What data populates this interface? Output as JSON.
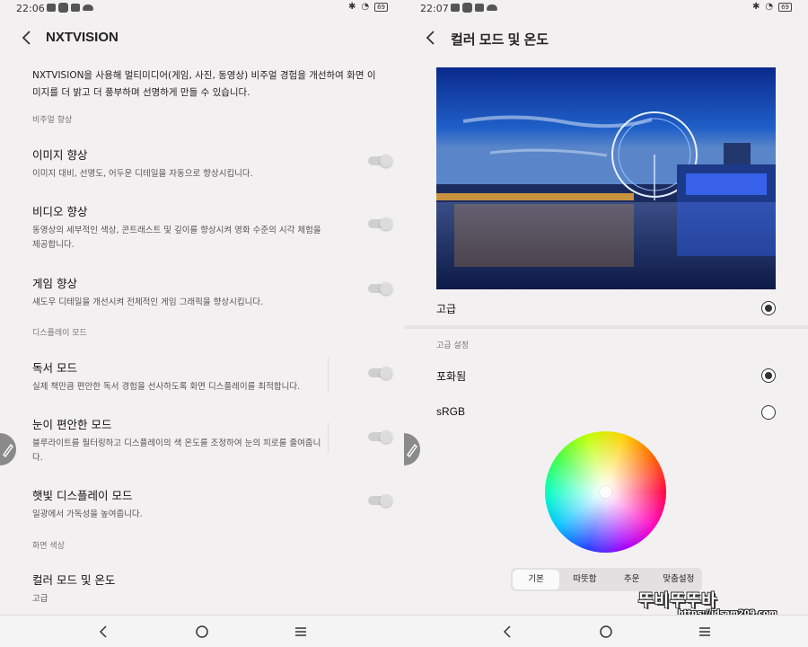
{
  "left": {
    "status": {
      "time": "22:06",
      "battery": "69"
    },
    "title": "NXTVISION",
    "description": "NXTVISION을 사용해 멀티미디어(게임, 사진, 동영상) 비주얼 경험을 개선하여 화면 이미지를 더 밝고 더 풍부하며 선명하게 만들 수 있습니다.",
    "sections": {
      "visual": "비주얼 향상",
      "display": "디스플레이 모드",
      "color": "화면 색상"
    },
    "items": [
      {
        "title": "이미지 향상",
        "sub": "이미지 대비, 선명도, 어두운 디테일을 자동으로 향상시킵니다.",
        "enabled": false
      },
      {
        "title": "비디오 향상",
        "sub": "동영상의 세부적인 색상, 콘트래스트 및 깊이를 향상시켜 영화 수준의 시각 체험을 제공합니다.",
        "enabled": false
      },
      {
        "title": "게임 향상",
        "sub": "섀도우 디테일을 개선시켜 전체적인 게임 그래픽을 향상시킵니다.",
        "enabled": false
      },
      {
        "title": "독서 모드",
        "sub": "실제 책만큼 편안한 독서 경험을 선사하도록 화면 디스플레이를 최적합니다.",
        "enabled": false
      },
      {
        "title": "눈이 편안한 모드",
        "sub": "블루라이트를 필터링하고 디스플레이의 색 온도를 조정하여 눈의 피로를 줄여줍니다.",
        "enabled": false
      },
      {
        "title": "햇빛 디스플레이 모드",
        "sub": "일광에서 가독성을 높여줍니다.",
        "enabled": false
      }
    ],
    "color_mode": {
      "title": "컬러 모드 및 온도",
      "value": "고급"
    }
  },
  "right": {
    "status": {
      "time": "22:07",
      "battery": "69"
    },
    "title": "컬러 모드 및 온도",
    "preview_image": "london-eye-night-river",
    "mode_label": "고급",
    "advanced_section": "고급 설정",
    "options": [
      {
        "label": "포화됨",
        "selected": true
      },
      {
        "label": "sRGB",
        "selected": false
      }
    ],
    "presets": [
      "기본",
      "따뜻함",
      "추운",
      "맞춤설정"
    ],
    "active_preset": "기본",
    "watermark": {
      "text": "뚜비뚜뚜바",
      "url": "https://idsam209.com"
    }
  },
  "icons": {
    "back": "back-arrow-icon",
    "nav_back": "nav-back-icon",
    "nav_home": "nav-home-icon",
    "nav_recents": "nav-recents-icon",
    "edit": "pencil-icon"
  },
  "colors": {
    "background": "#f2f0f1",
    "toggle_off": "#cfcfcf",
    "text": "#111111"
  }
}
